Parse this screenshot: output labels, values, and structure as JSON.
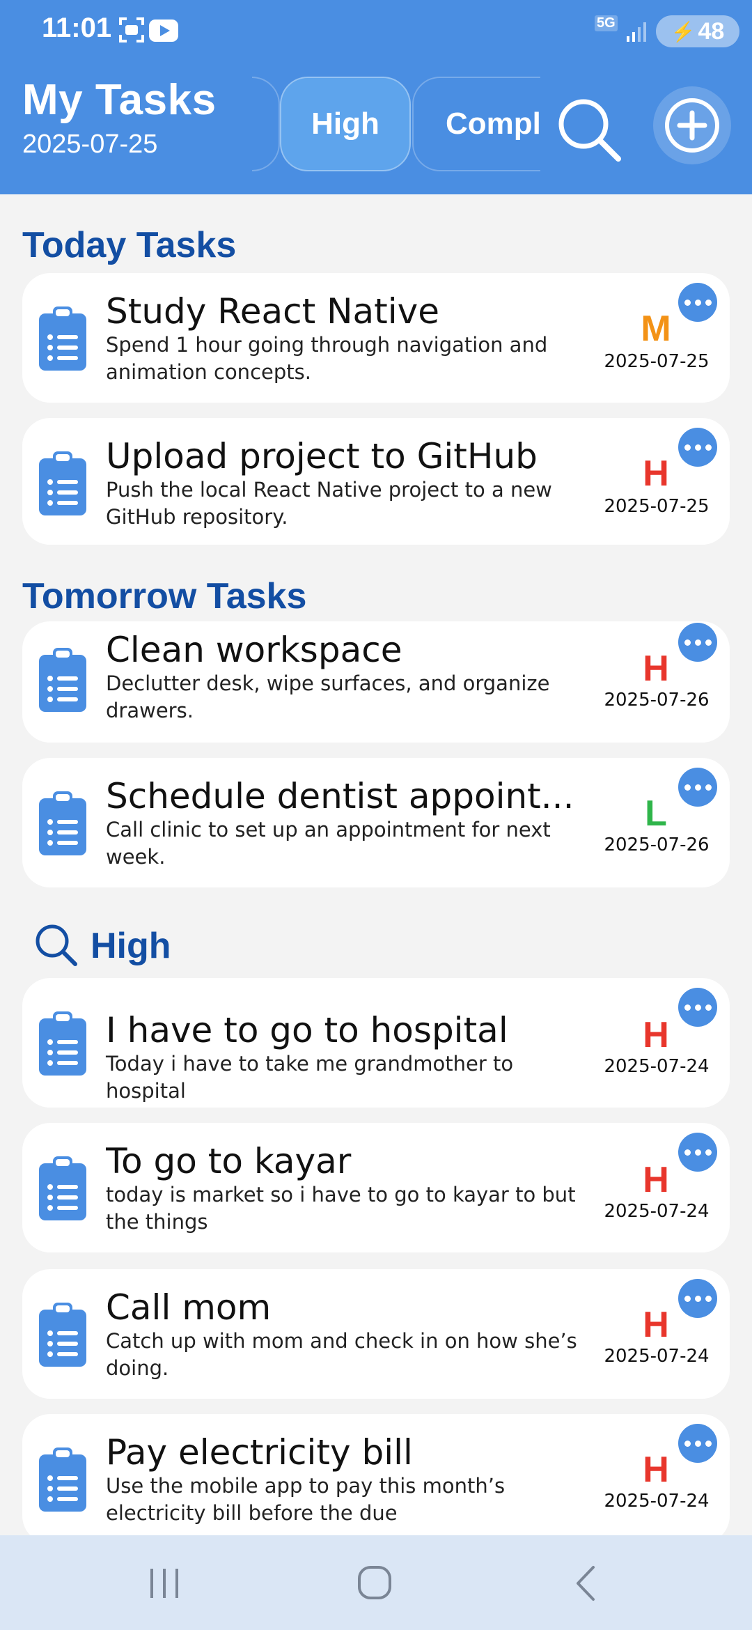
{
  "status": {
    "time": "11:01",
    "network": "5G",
    "battery": "48"
  },
  "header": {
    "title": "My Tasks",
    "date": "2025-07-25",
    "filters": [
      {
        "label": ""
      },
      {
        "label": "High"
      },
      {
        "label": "Compl"
      }
    ]
  },
  "sections": [
    {
      "title": "Today Tasks",
      "tasks": [
        {
          "title": "Study React Native",
          "desc": "Spend 1 hour going through navigation and animation concepts.",
          "priority": "M",
          "date": "2025-07-25"
        },
        {
          "title": "Upload project to GitHub",
          "desc": "Push the local React Native project to a new GitHub repository.",
          "priority": "H",
          "date": "2025-07-25"
        }
      ]
    },
    {
      "title": "Tomorrow Tasks",
      "tasks": [
        {
          "title": "Clean workspace",
          "desc": "Declutter desk, wipe surfaces, and organize drawers.",
          "priority": "H",
          "date": "2025-07-26"
        },
        {
          "title": "Schedule dentist appoint...",
          "desc": "Call clinic to set up an appointment for next week.",
          "priority": "L",
          "date": "2025-07-26"
        }
      ]
    },
    {
      "title": "High",
      "tasks": [
        {
          "title": "I have to go to hospital",
          "desc": "Today i have to take me grandmother to hospital",
          "priority": "H",
          "date": "2025-07-24"
        },
        {
          "title": "To go to kayar",
          "desc": "today is market so i have to go to kayar to but the things",
          "priority": "H",
          "date": "2025-07-24"
        },
        {
          "title": "Call mom",
          "desc": "Catch up with mom and check in on how she’s doing.",
          "priority": "H",
          "date": "2025-07-24"
        },
        {
          "title": "Pay electricity bill",
          "desc": "Use the mobile app to pay this month’s electricity bill before the due",
          "priority": "H",
          "date": "2025-07-24"
        }
      ]
    }
  ],
  "colors": {
    "header_bg": "#4a8ee2",
    "section_title": "#134ea3",
    "priority_H": "#e8362c",
    "priority_M": "#f39216",
    "priority_L": "#2fb54a",
    "icon_blue": "#4a8ee2"
  },
  "icons": {
    "task_icon": "clipboard-list-icon",
    "more_icon": "more-horizontal-icon",
    "search_icon": "search-icon",
    "add_icon": "add-circle-icon"
  }
}
